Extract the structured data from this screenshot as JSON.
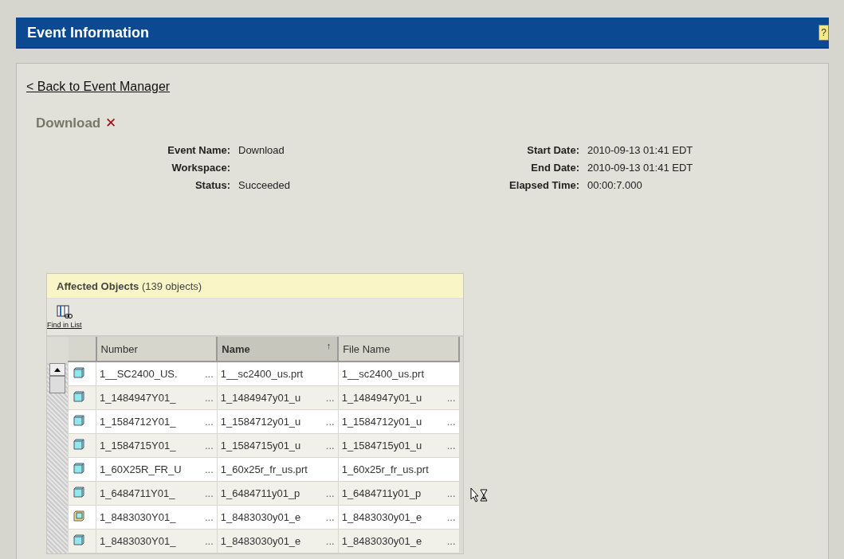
{
  "header": {
    "title": "Event Information",
    "help": "?"
  },
  "back_link": "< Back to Event Manager",
  "event": {
    "title": "Download",
    "delete": "✕"
  },
  "details_left": [
    {
      "label": "Event Name:",
      "value": "Download"
    },
    {
      "label": "Workspace:"
    },
    {
      "label": "Status:",
      "value": "Succeeded"
    }
  ],
  "details_right": [
    {
      "label": "Start Date:",
      "value": "2010-09-13 01:41 EDT"
    },
    {
      "label": "End Date:",
      "value": "2010-09-13 01:41 EDT"
    },
    {
      "label": "Elapsed Time:",
      "value": "00:00:7.000"
    }
  ],
  "affected": {
    "title": "Affected Objects",
    "count": "(139 objects)",
    "find_label": "Find in List",
    "columns": [
      {
        "label": "Number",
        "sorted": false
      },
      {
        "label": "Name",
        "sorted": true,
        "sort_mark": "↑"
      },
      {
        "label": "File Name",
        "sorted": false
      }
    ],
    "rows": [
      {
        "kind": "part",
        "cells": [
          {
            "text": "1__SC2400_US.",
            "ellipsis": "..."
          },
          {
            "text": "1__sc2400_us.prt"
          },
          {
            "text": "1__sc2400_us.prt"
          }
        ]
      },
      {
        "kind": "part",
        "cells": [
          {
            "text": "1_1484947Y01_",
            "ellipsis": "..."
          },
          {
            "text": "1_1484947y01_u",
            "ellipsis": "..."
          },
          {
            "text": "1_1484947y01_u",
            "ellipsis": "..."
          }
        ]
      },
      {
        "kind": "part",
        "cells": [
          {
            "text": "1_1584712Y01_",
            "ellipsis": "..."
          },
          {
            "text": "1_1584712y01_u",
            "ellipsis": "..."
          },
          {
            "text": "1_1584712y01_u",
            "ellipsis": "..."
          }
        ]
      },
      {
        "kind": "part",
        "cells": [
          {
            "text": "1_1584715Y01_",
            "ellipsis": "..."
          },
          {
            "text": "1_1584715y01_u",
            "ellipsis": "..."
          },
          {
            "text": "1_1584715y01_u",
            "ellipsis": "..."
          }
        ]
      },
      {
        "kind": "part",
        "cells": [
          {
            "text": "1_60X25R_FR_U",
            "ellipsis": "..."
          },
          {
            "text": "1_60x25r_fr_us.prt"
          },
          {
            "text": "1_60x25r_fr_us.prt"
          }
        ]
      },
      {
        "kind": "part",
        "cells": [
          {
            "text": "1_6484711Y01_",
            "ellipsis": "..."
          },
          {
            "text": "1_6484711y01_p",
            "ellipsis": "..."
          },
          {
            "text": "1_6484711y01_p",
            "ellipsis": "..."
          }
        ]
      },
      {
        "kind": "assembly",
        "cells": [
          {
            "text": "1_8483030Y01_",
            "ellipsis": "..."
          },
          {
            "text": "1_8483030y01_e",
            "ellipsis": "..."
          },
          {
            "text": "1_8483030y01_e",
            "ellipsis": "..."
          }
        ]
      },
      {
        "kind": "part",
        "cells": [
          {
            "text": "1_8483030Y01_",
            "ellipsis": "..."
          },
          {
            "text": "1_8483030y01_e",
            "ellipsis": "..."
          },
          {
            "text": "1_8483030y01_e",
            "ellipsis": "..."
          }
        ]
      }
    ]
  }
}
